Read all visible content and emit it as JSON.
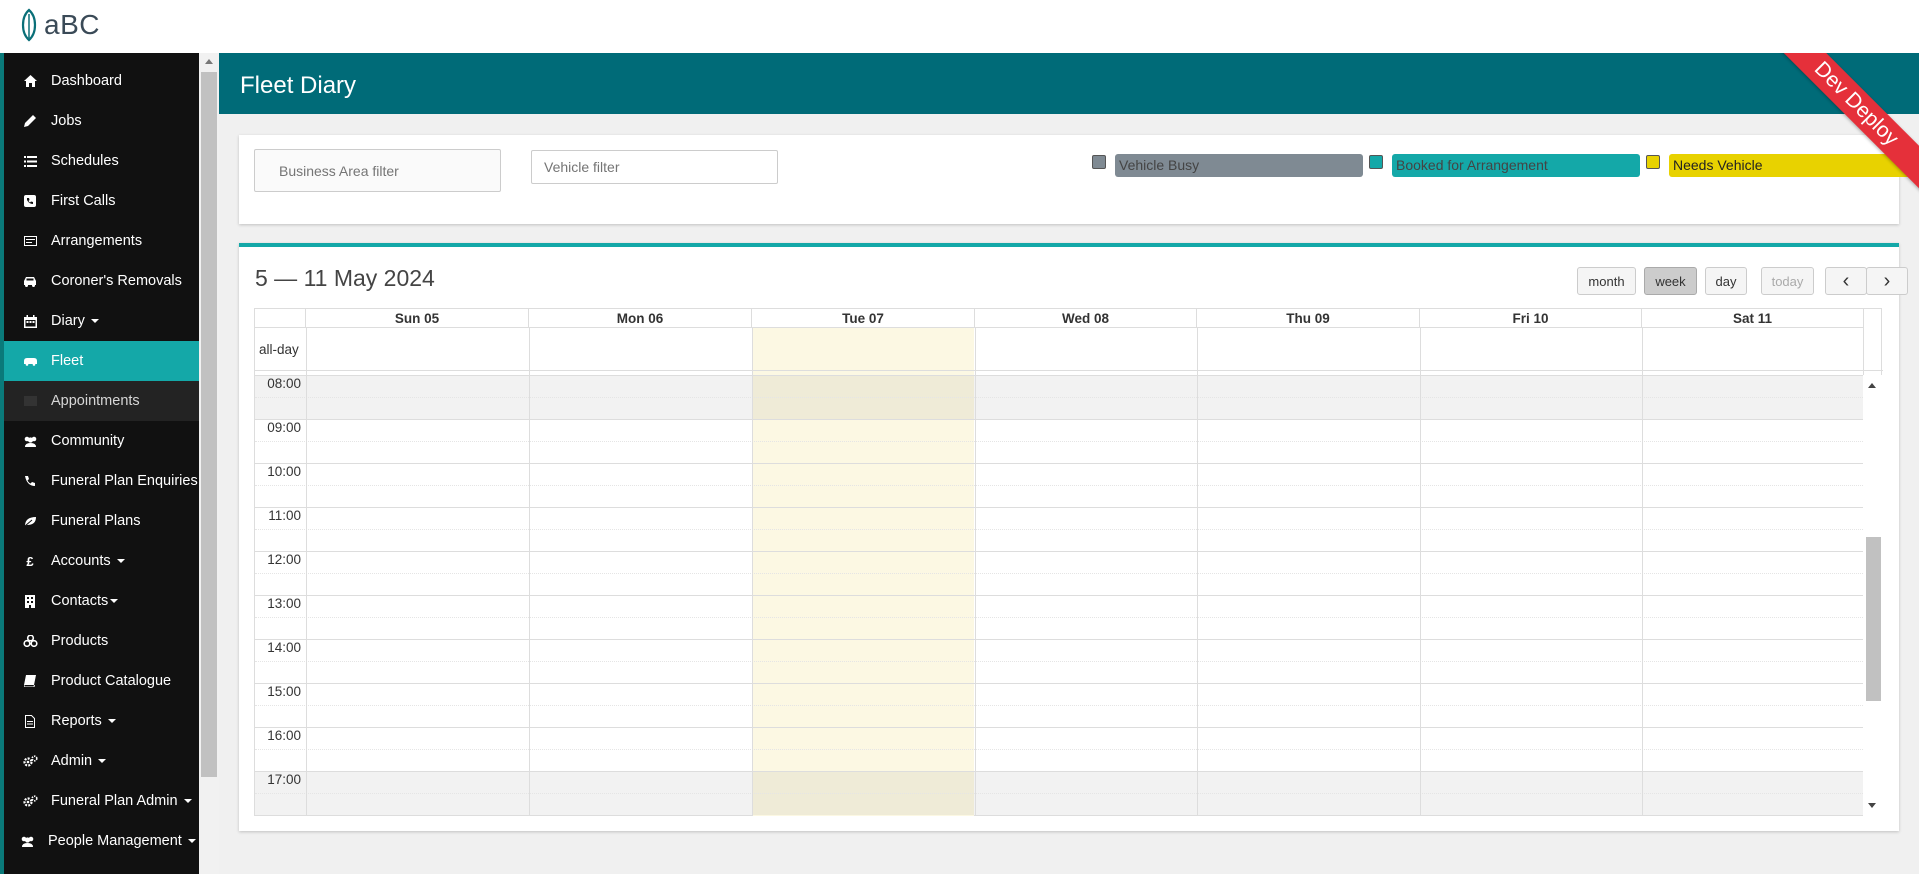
{
  "app": {
    "logo_text": "aBC"
  },
  "sidebar": {
    "items": [
      {
        "label": "Dashboard",
        "icon": "home-icon"
      },
      {
        "label": "Jobs",
        "icon": "pencil-icon"
      },
      {
        "label": "Schedules",
        "icon": "list-icon"
      },
      {
        "label": "First Calls",
        "icon": "phone-square-icon"
      },
      {
        "label": "Arrangements",
        "icon": "card-icon"
      },
      {
        "label": "Coroner's Removals",
        "icon": "car-icon"
      },
      {
        "label": "Diary",
        "icon": "calendar-icon"
      },
      {
        "label": "Fleet",
        "icon": "bus-icon"
      },
      {
        "label": "Appointments",
        "icon": "card-icon"
      },
      {
        "label": "Community",
        "icon": "users-icon"
      },
      {
        "label": "Funeral Plan Enquiries",
        "icon": "phone-icon"
      },
      {
        "label": "Funeral Plans",
        "icon": "leaf-icon"
      },
      {
        "label": "Accounts",
        "icon": "pound-icon"
      },
      {
        "label": "Contacts",
        "icon": "building-icon"
      },
      {
        "label": "Products",
        "icon": "cubes-icon"
      },
      {
        "label": "Product Catalogue",
        "icon": "book-icon"
      },
      {
        "label": "Reports",
        "icon": "file-icon"
      },
      {
        "label": "Admin",
        "icon": "cogs-icon"
      },
      {
        "label": "Funeral Plan Admin",
        "icon": "cogs-icon"
      },
      {
        "label": "People Management",
        "icon": "users-icon"
      }
    ]
  },
  "header": {
    "title": "Fleet Diary",
    "ribbon": "Dev Deploy"
  },
  "filters": {
    "business_area_placeholder": "Business Area filter",
    "vehicle_placeholder": "Vehicle filter"
  },
  "legend": [
    {
      "label": "Vehicle Busy",
      "color": "#7f8a93",
      "text_color": "#444444"
    },
    {
      "label": "Booked for Arrangement",
      "color": "#14a8a8",
      "text_color": "#444444"
    },
    {
      "label": "Needs Vehicle",
      "color": "#e8d200",
      "text_color": "#222222"
    }
  ],
  "calendar": {
    "title": "5 — 11 May 2024",
    "views": {
      "month": "month",
      "week": "week",
      "day": "day",
      "today": "today"
    },
    "prev_icon": "‹",
    "next_icon": "›",
    "allday_label": "all-day",
    "days": [
      "Sun 05",
      "Mon 06",
      "Tue 07",
      "Wed 08",
      "Thu 09",
      "Fri 10",
      "Sat 11"
    ],
    "today_index": 2,
    "times": [
      "08:00",
      "09:00",
      "10:00",
      "11:00",
      "12:00",
      "13:00",
      "14:00",
      "15:00",
      "16:00",
      "17:00"
    ]
  },
  "colors": {
    "header": "#006b78",
    "accent": "#14a8a8",
    "today": "#fcf8e3",
    "ribbon": "#e5303a"
  }
}
